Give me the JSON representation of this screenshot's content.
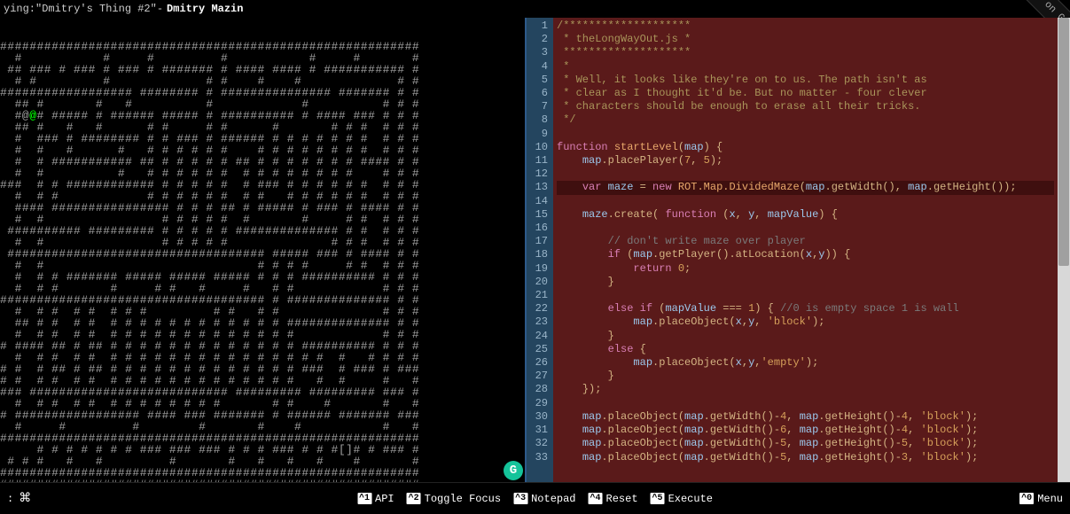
{
  "topbar": {
    "playing_prefix": "ying: ",
    "track": "\"Dmitry's Thing #2\"",
    "sep": " - ",
    "artist": "Dmitry Mazin"
  },
  "ribbon": "rk me on G",
  "maze_rows": [
    "#########################################################",
    "  #           #     #         #           #     #       #",
    " ## ### # ### # ### # ####### # #### #### # ########### #",
    "  # #         #             # #    #    #             # #",
    "################## ######## # ############### ####### # #",
    "  ## #       #   #          #            #          # # #",
    "  #@ # ##### # ###### ##### # ########## # #### ### # # #",
    "  ## #   #   #      # #     # #      #       # # #  # # #",
    "  #  ### # ######## # # ### # ###### # # # # # # #  # # #",
    "  #  #   #      #   # # # # # #    # # # # # # # #  # # #",
    "  #  # ########### ## # # # # # ## # # # # # # # #### # #",
    "  #  #          #   # # # # # #  # # # # # # # #    # # #",
    "###  # # ############ # # # # #  # ### # # # # # #  # # #",
    "  #  # #            # # # # # #  # #   # # # # # #  # # #",
    "  #### ################ # # # ## # ##### # ### # #### # #",
    "  #  #                # # # # #  #       #     # #  # # #",
    " ########## ######### # # # # # ############## # #  # # #",
    "  #  #                # # # # #              # # #  # # #",
    " ################################### ##### ### # #### # #",
    "  #  #                             # # # #     # #  # # #",
    "  #  # # ####### ##### ##### ##### # # # ########## # # #",
    "  #  # #       #     # #   #     #   # #            # # #",
    "#################################### # ############## # #",
    "  #  # #  # #  # # #         # #   # #              # # #",
    "  ## # #  # #  # # # # # # # # # # # # ############## # #",
    "  #  # #  # #  # # # # # # # # # # # # #            # # #",
    "# #### ## # ## # # # # # # # # # # # # # ########## # # #",
    "  #  # #  # #  # # # # # # # # # # # # # # #  #   # # # #",
    "# #  # ## # ## # # # # # # # # # # # # # ###  # ### # ###",
    "# #  # #  # #  # # # # # # # # # # # # #   #  #     #   #",
    "### ########################### ######### ######### ### #",
    "  #  # #  # #  # # # # # # # #       # #    #       #   #",
    "# ################# #### ### ####### # ###### ####### ###",
    "  #     #         #        #       #    #           #   #",
    "#########################################################",
    "     # # # # # # # ### ### ### # # # ### # # #[]# # ### #",
    " # # #   #   #         #       #   #   #   #    #       #",
    "#########################################################",
    "#########################################################"
  ],
  "player_row": 6,
  "player_col": 4,
  "code_lines": [
    {
      "n": 1,
      "t": "comment-star",
      "s": "/********************"
    },
    {
      "n": 2,
      "t": "comment-star",
      "s": " * theLongWayOut.js *"
    },
    {
      "n": 3,
      "t": "comment-star",
      "s": " ********************"
    },
    {
      "n": 4,
      "t": "comment-star",
      "s": " *"
    },
    {
      "n": 5,
      "t": "comment-star",
      "s": " * Well, it looks like they're on to us. The path isn't as"
    },
    {
      "n": 6,
      "t": "comment-star",
      "s": " * clear as I thought it'd be. But no matter - four clever"
    },
    {
      "n": 7,
      "t": "comment-star",
      "s": " * characters should be enough to erase all their tricks."
    },
    {
      "n": 8,
      "t": "comment-star",
      "s": " */"
    },
    {
      "n": 9,
      "t": "blank",
      "s": ""
    },
    {
      "n": 10,
      "t": "code",
      "tokens": [
        [
          "keyword",
          "function"
        ],
        [
          "plain",
          " "
        ],
        [
          "def",
          "startLevel"
        ],
        [
          "punct",
          "("
        ],
        [
          "var",
          "map"
        ],
        [
          "punct",
          ") {"
        ]
      ]
    },
    {
      "n": 11,
      "t": "code",
      "tokens": [
        [
          "plain",
          "    "
        ],
        [
          "var",
          "map"
        ],
        [
          "punct",
          "."
        ],
        [
          "fn",
          "placePlayer"
        ],
        [
          "punct",
          "("
        ],
        [
          "number",
          "7"
        ],
        [
          "punct",
          ", "
        ],
        [
          "number",
          "5"
        ],
        [
          "punct",
          ");"
        ]
      ]
    },
    {
      "n": 12,
      "t": "blank",
      "s": ""
    },
    {
      "n": 13,
      "t": "code",
      "hl": true,
      "tokens": [
        [
          "plain",
          "    "
        ],
        [
          "keyword",
          "var"
        ],
        [
          "plain",
          " "
        ],
        [
          "var",
          "maze"
        ],
        [
          "plain",
          " = "
        ],
        [
          "keyword",
          "new"
        ],
        [
          "plain",
          " "
        ],
        [
          "def",
          "ROT.Map.DividedMaze"
        ],
        [
          "punct",
          "("
        ],
        [
          "var",
          "map"
        ],
        [
          "punct",
          "."
        ],
        [
          "fn",
          "getWidth"
        ],
        [
          "punct",
          "(), "
        ],
        [
          "var",
          "map"
        ],
        [
          "punct",
          "."
        ],
        [
          "fn",
          "getHeight"
        ],
        [
          "punct",
          "());"
        ]
      ]
    },
    {
      "n": 14,
      "t": "blank",
      "s": ""
    },
    {
      "n": 15,
      "t": "code",
      "tokens": [
        [
          "plain",
          "    "
        ],
        [
          "var",
          "maze"
        ],
        [
          "punct",
          "."
        ],
        [
          "fn",
          "create"
        ],
        [
          "punct",
          "( "
        ],
        [
          "keyword",
          "function"
        ],
        [
          "plain",
          " "
        ],
        [
          "punct",
          "("
        ],
        [
          "var",
          "x"
        ],
        [
          "punct",
          ", "
        ],
        [
          "var",
          "y"
        ],
        [
          "punct",
          ", "
        ],
        [
          "var",
          "mapValue"
        ],
        [
          "punct",
          ") {"
        ]
      ]
    },
    {
      "n": 16,
      "t": "blank",
      "s": ""
    },
    {
      "n": 17,
      "t": "code",
      "tokens": [
        [
          "plain",
          "        "
        ],
        [
          "comment",
          "// don't write maze over player"
        ]
      ]
    },
    {
      "n": 18,
      "t": "code",
      "tokens": [
        [
          "plain",
          "        "
        ],
        [
          "keyword",
          "if"
        ],
        [
          "plain",
          " "
        ],
        [
          "punct",
          "("
        ],
        [
          "var",
          "map"
        ],
        [
          "punct",
          "."
        ],
        [
          "fn",
          "getPlayer"
        ],
        [
          "punct",
          "()."
        ],
        [
          "fn",
          "atLocation"
        ],
        [
          "punct",
          "("
        ],
        [
          "var",
          "x"
        ],
        [
          "punct",
          ","
        ],
        [
          "var",
          "y"
        ],
        [
          "punct",
          ")) {"
        ]
      ]
    },
    {
      "n": 19,
      "t": "code",
      "tokens": [
        [
          "plain",
          "            "
        ],
        [
          "keyword",
          "return"
        ],
        [
          "plain",
          " "
        ],
        [
          "number",
          "0"
        ],
        [
          "punct",
          ";"
        ]
      ]
    },
    {
      "n": 20,
      "t": "code",
      "tokens": [
        [
          "plain",
          "        "
        ],
        [
          "punct",
          "}"
        ]
      ]
    },
    {
      "n": 21,
      "t": "blank",
      "s": ""
    },
    {
      "n": 22,
      "t": "code",
      "tokens": [
        [
          "plain",
          "        "
        ],
        [
          "keyword",
          "else if"
        ],
        [
          "plain",
          " "
        ],
        [
          "punct",
          "("
        ],
        [
          "var",
          "mapValue"
        ],
        [
          "plain",
          " === "
        ],
        [
          "number",
          "1"
        ],
        [
          "punct",
          ") { "
        ],
        [
          "comment",
          "//0 is empty space 1 is wall"
        ]
      ]
    },
    {
      "n": 23,
      "t": "code",
      "tokens": [
        [
          "plain",
          "            "
        ],
        [
          "var",
          "map"
        ],
        [
          "punct",
          "."
        ],
        [
          "fn",
          "placeObject"
        ],
        [
          "punct",
          "("
        ],
        [
          "var",
          "x"
        ],
        [
          "punct",
          ","
        ],
        [
          "var",
          "y"
        ],
        [
          "punct",
          ", "
        ],
        [
          "string",
          "'block'"
        ],
        [
          "punct",
          ");"
        ]
      ]
    },
    {
      "n": 24,
      "t": "code",
      "tokens": [
        [
          "plain",
          "        "
        ],
        [
          "punct",
          "}"
        ]
      ]
    },
    {
      "n": 25,
      "t": "code",
      "tokens": [
        [
          "plain",
          "        "
        ],
        [
          "keyword",
          "else"
        ],
        [
          "plain",
          " "
        ],
        [
          "punct",
          "{"
        ]
      ]
    },
    {
      "n": 26,
      "t": "code",
      "tokens": [
        [
          "plain",
          "            "
        ],
        [
          "var",
          "map"
        ],
        [
          "punct",
          "."
        ],
        [
          "fn",
          "placeObject"
        ],
        [
          "punct",
          "("
        ],
        [
          "var",
          "x"
        ],
        [
          "punct",
          ","
        ],
        [
          "var",
          "y"
        ],
        [
          "punct",
          ","
        ],
        [
          "string",
          "'empty'"
        ],
        [
          "punct",
          ");"
        ]
      ]
    },
    {
      "n": 27,
      "t": "code",
      "tokens": [
        [
          "plain",
          "        "
        ],
        [
          "punct",
          "}"
        ]
      ]
    },
    {
      "n": 28,
      "t": "code",
      "tokens": [
        [
          "plain",
          "    "
        ],
        [
          "punct",
          "});"
        ]
      ]
    },
    {
      "n": 29,
      "t": "blank",
      "s": ""
    },
    {
      "n": 30,
      "t": "code",
      "tokens": [
        [
          "plain",
          "    "
        ],
        [
          "var",
          "map"
        ],
        [
          "punct",
          "."
        ],
        [
          "fn",
          "placeObject"
        ],
        [
          "punct",
          "("
        ],
        [
          "var",
          "map"
        ],
        [
          "punct",
          "."
        ],
        [
          "fn",
          "getWidth"
        ],
        [
          "punct",
          "()-"
        ],
        [
          "number",
          "4"
        ],
        [
          "punct",
          ", "
        ],
        [
          "var",
          "map"
        ],
        [
          "punct",
          "."
        ],
        [
          "fn",
          "getHeight"
        ],
        [
          "punct",
          "()-"
        ],
        [
          "number",
          "4"
        ],
        [
          "punct",
          ", "
        ],
        [
          "string",
          "'block'"
        ],
        [
          "punct",
          ");"
        ]
      ]
    },
    {
      "n": 31,
      "t": "code",
      "tokens": [
        [
          "plain",
          "    "
        ],
        [
          "var",
          "map"
        ],
        [
          "punct",
          "."
        ],
        [
          "fn",
          "placeObject"
        ],
        [
          "punct",
          "("
        ],
        [
          "var",
          "map"
        ],
        [
          "punct",
          "."
        ],
        [
          "fn",
          "getWidth"
        ],
        [
          "punct",
          "()-"
        ],
        [
          "number",
          "6"
        ],
        [
          "punct",
          ", "
        ],
        [
          "var",
          "map"
        ],
        [
          "punct",
          "."
        ],
        [
          "fn",
          "getHeight"
        ],
        [
          "punct",
          "()-"
        ],
        [
          "number",
          "4"
        ],
        [
          "punct",
          ", "
        ],
        [
          "string",
          "'block'"
        ],
        [
          "punct",
          ");"
        ]
      ]
    },
    {
      "n": 32,
      "t": "code",
      "tokens": [
        [
          "plain",
          "    "
        ],
        [
          "var",
          "map"
        ],
        [
          "punct",
          "."
        ],
        [
          "fn",
          "placeObject"
        ],
        [
          "punct",
          "("
        ],
        [
          "var",
          "map"
        ],
        [
          "punct",
          "."
        ],
        [
          "fn",
          "getWidth"
        ],
        [
          "punct",
          "()-"
        ],
        [
          "number",
          "5"
        ],
        [
          "punct",
          ", "
        ],
        [
          "var",
          "map"
        ],
        [
          "punct",
          "."
        ],
        [
          "fn",
          "getHeight"
        ],
        [
          "punct",
          "()-"
        ],
        [
          "number",
          "5"
        ],
        [
          "punct",
          ", "
        ],
        [
          "string",
          "'block'"
        ],
        [
          "punct",
          ");"
        ]
      ]
    },
    {
      "n": 33,
      "t": "code",
      "tokens": [
        [
          "plain",
          "    "
        ],
        [
          "var",
          "map"
        ],
        [
          "punct",
          "."
        ],
        [
          "fn",
          "placeObject"
        ],
        [
          "punct",
          "("
        ],
        [
          "var",
          "map"
        ],
        [
          "punct",
          "."
        ],
        [
          "fn",
          "getWidth"
        ],
        [
          "punct",
          "()-"
        ],
        [
          "number",
          "5"
        ],
        [
          "punct",
          ", "
        ],
        [
          "var",
          "map"
        ],
        [
          "punct",
          "."
        ],
        [
          "fn",
          "getHeight"
        ],
        [
          "punct",
          "()-"
        ],
        [
          "number",
          "3"
        ],
        [
          "punct",
          ", "
        ],
        [
          "string",
          "'block'"
        ],
        [
          "punct",
          ");"
        ]
      ]
    }
  ],
  "shortcuts": [
    {
      "key": "^1",
      "label": "API"
    },
    {
      "key": "^2",
      "label": "Toggle Focus"
    },
    {
      "key": "^3",
      "label": "Notepad"
    },
    {
      "key": "^4",
      "label": "Reset"
    },
    {
      "key": "^5",
      "label": "Execute"
    }
  ],
  "menu": {
    "key": "^0",
    "label": "Menu"
  },
  "prompt": ":",
  "cmd_glyph": "⌘"
}
